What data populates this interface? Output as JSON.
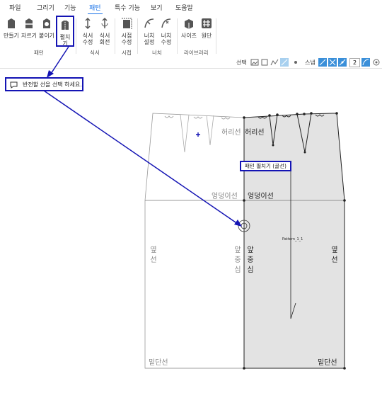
{
  "menu": {
    "items": [
      "파일",
      "그리기",
      "기능",
      "패턴",
      "특수 기능",
      "보기",
      "도움말"
    ],
    "active": "패턴"
  },
  "ribbon": {
    "buttons": [
      {
        "label1": "만들기",
        "label2": ""
      },
      {
        "label1": "자르기",
        "label2": ""
      },
      {
        "label1": "붙이기",
        "label2": ""
      },
      {
        "label1": "펼치기",
        "label2": ""
      },
      {
        "label1": "식서",
        "label2": "수정"
      },
      {
        "label1": "식서",
        "label2": "회전"
      },
      {
        "label1": "시접",
        "label2": "수정"
      },
      {
        "label1": "너치",
        "label2": "설정"
      },
      {
        "label1": "너치",
        "label2": "수정"
      },
      {
        "label1": "사이즈",
        "label2": ""
      },
      {
        "label1": "원단",
        "label2": ""
      }
    ],
    "groups": [
      "패턴",
      "식서",
      "시접",
      "너치",
      "라이브러리"
    ]
  },
  "toolbar": {
    "select_label": "선택",
    "snap_label": "스냅",
    "snap_value": "2"
  },
  "prompt": {
    "text": "반전할 선을 선택 하세요."
  },
  "tooltip": {
    "text": "패턴 펼치기 (골선)"
  },
  "pattern": {
    "waist_left": "허리선",
    "waist_right": "허리선",
    "hip_left": "엉덩이선",
    "hip_right": "엉덩이선",
    "side_left": "옆선",
    "side_right": "옆선",
    "center_left": "앞중심",
    "center_right": "앞중심",
    "hem_left": "밑단선",
    "hem_right": "밑단선",
    "piece_name": "Pattern_1_1"
  }
}
